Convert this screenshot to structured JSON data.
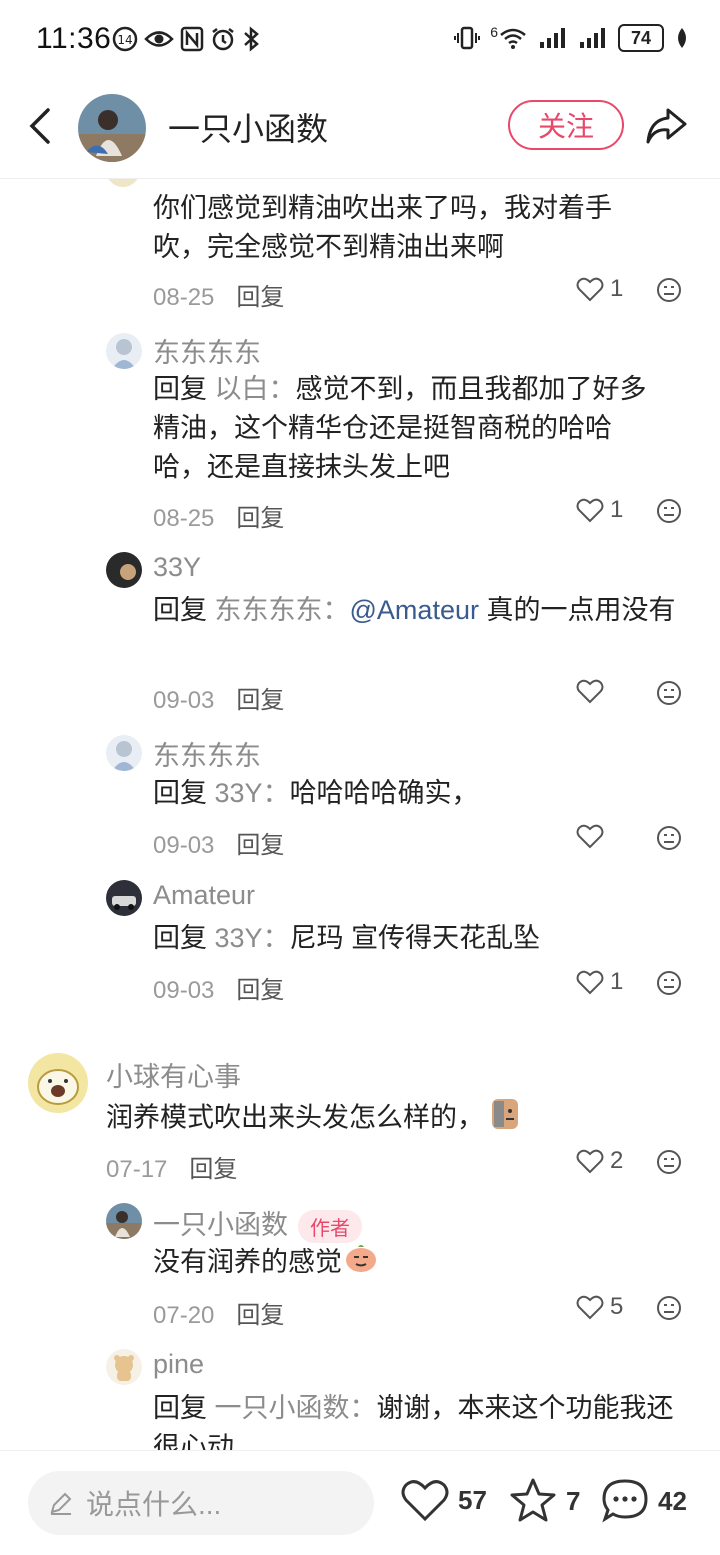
{
  "status_bar": {
    "time": "11:36",
    "battery": "74",
    "signal_label": "6"
  },
  "header": {
    "author_name": "一只小函数",
    "follow_label": "关注"
  },
  "reply_prefix": "回复",
  "comments": [
    {
      "text": "你们感觉到精油吹出来了吗，我对着手吹，完全感觉不到精油出来啊",
      "date": "08-25",
      "reply_label": "回复",
      "likes": "1"
    },
    {
      "name": "东东东东",
      "reply_to": "以白",
      "text": "感觉不到，而且我都加了好多精油，这个精华仓还是挺智商税的哈哈哈，还是直接抹头发上吧",
      "date": "08-25",
      "reply_label": "回复",
      "likes": "1"
    },
    {
      "name": "33Y",
      "reply_to": "东东东东",
      "mention": "@Amateur",
      "text": " 真的一点用没有",
      "date": "09-03",
      "reply_label": "回复"
    },
    {
      "name": "东东东东",
      "reply_to": "33Y",
      "text": "哈哈哈哈确实，",
      "date": "09-03",
      "reply_label": "回复"
    },
    {
      "name": "Amateur",
      "reply_to": "33Y",
      "text": "尼玛 宣传得天花乱坠",
      "date": "09-03",
      "reply_label": "回复",
      "likes": "1"
    },
    {
      "name": "小球有心事",
      "text": "润养模式吹出来头发怎么样的，",
      "date": "07-17",
      "reply_label": "回复",
      "likes": "2"
    },
    {
      "name": "一只小函数",
      "author_tag": "作者",
      "text": "没有润养的感觉",
      "date": "07-20",
      "reply_label": "回复",
      "likes": "5"
    },
    {
      "name": "pine",
      "reply_to": "一只小函数",
      "text": "谢谢，本来这个功能我还很心动"
    }
  ],
  "bottom_bar": {
    "input_placeholder": "说点什么...",
    "likes": "57",
    "collects": "7",
    "comments": "42"
  },
  "colors": {
    "accent": "#e8486a",
    "mention": "#3a5b8f",
    "muted": "#8c8c8c"
  }
}
